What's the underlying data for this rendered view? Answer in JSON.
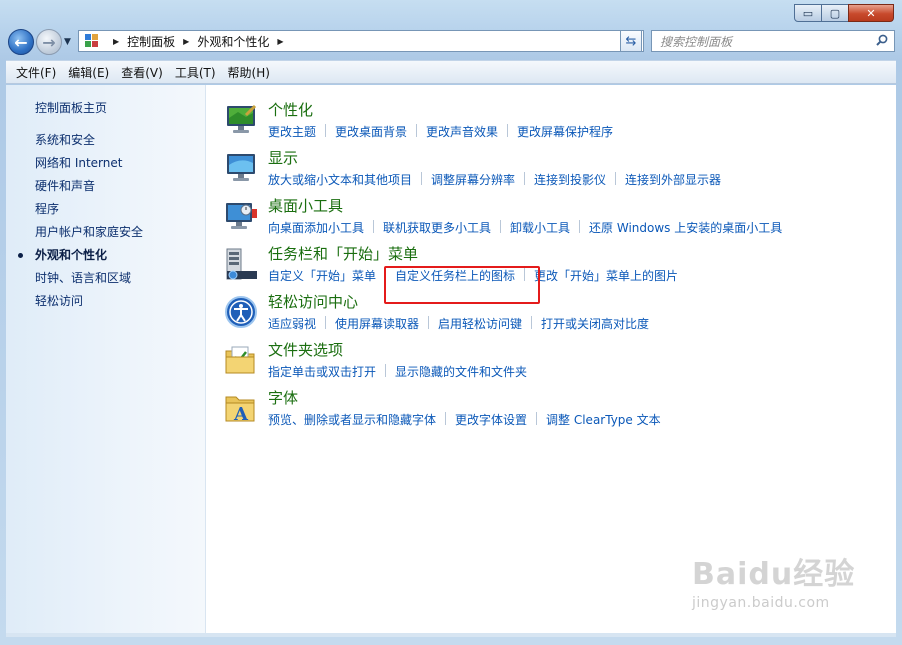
{
  "window": {
    "caption": {
      "minimize": "▭",
      "maximize": "▢",
      "close": "✕"
    }
  },
  "address_bar": {
    "crumbs": [
      "控制面板",
      "外观和个性化"
    ],
    "search_placeholder": "搜索控制面板"
  },
  "menu": [
    "文件(F)",
    "编辑(E)",
    "查看(V)",
    "工具(T)",
    "帮助(H)"
  ],
  "sidebar": {
    "home": "控制面板主页",
    "items": [
      {
        "label": "系统和安全",
        "active": false
      },
      {
        "label": "网络和 Internet",
        "active": false
      },
      {
        "label": "硬件和声音",
        "active": false
      },
      {
        "label": "程序",
        "active": false
      },
      {
        "label": "用户帐户和家庭安全",
        "active": false
      },
      {
        "label": "外观和个性化",
        "active": true
      },
      {
        "label": "时钟、语言和区域",
        "active": false
      },
      {
        "label": "轻松访问",
        "active": false
      }
    ]
  },
  "categories": [
    {
      "title": "个性化",
      "icon": "personalization-icon",
      "links": [
        "更改主题",
        "更改桌面背景",
        "更改声音效果",
        "更改屏幕保护程序"
      ]
    },
    {
      "title": "显示",
      "icon": "display-icon",
      "links": [
        "放大或缩小文本和其他项目",
        "调整屏幕分辨率",
        "连接到投影仪",
        "连接到外部显示器"
      ]
    },
    {
      "title": "桌面小工具",
      "icon": "gadgets-icon",
      "links": [
        "向桌面添加小工具",
        "联机获取更多小工具",
        "卸载小工具",
        "还原 Windows 上安装的桌面小工具"
      ]
    },
    {
      "title": "任务栏和「开始」菜单",
      "icon": "taskbar-icon",
      "links": [
        "自定义「开始」菜单",
        "自定义任务栏上的图标",
        "更改「开始」菜单上的图片"
      ]
    },
    {
      "title": "轻松访问中心",
      "icon": "ease-of-access-icon",
      "links": [
        "适应弱视",
        "使用屏幕读取器",
        "启用轻松访问键",
        "打开或关闭高对比度"
      ]
    },
    {
      "title": "文件夹选项",
      "icon": "folder-options-icon",
      "links": [
        "指定单击或双击打开",
        "显示隐藏的文件和文件夹"
      ]
    },
    {
      "title": "字体",
      "icon": "fonts-icon",
      "links": [
        "预览、删除或者显示和隐藏字体",
        "更改字体设置",
        "调整 ClearType 文本"
      ]
    }
  ],
  "watermark": {
    "logo": "Baidu经验",
    "url": "jingyan.baidu.com"
  },
  "colors": {
    "link": "#0b58b8",
    "category_title": "#1a6e0f",
    "highlight": "#e41b1b"
  }
}
